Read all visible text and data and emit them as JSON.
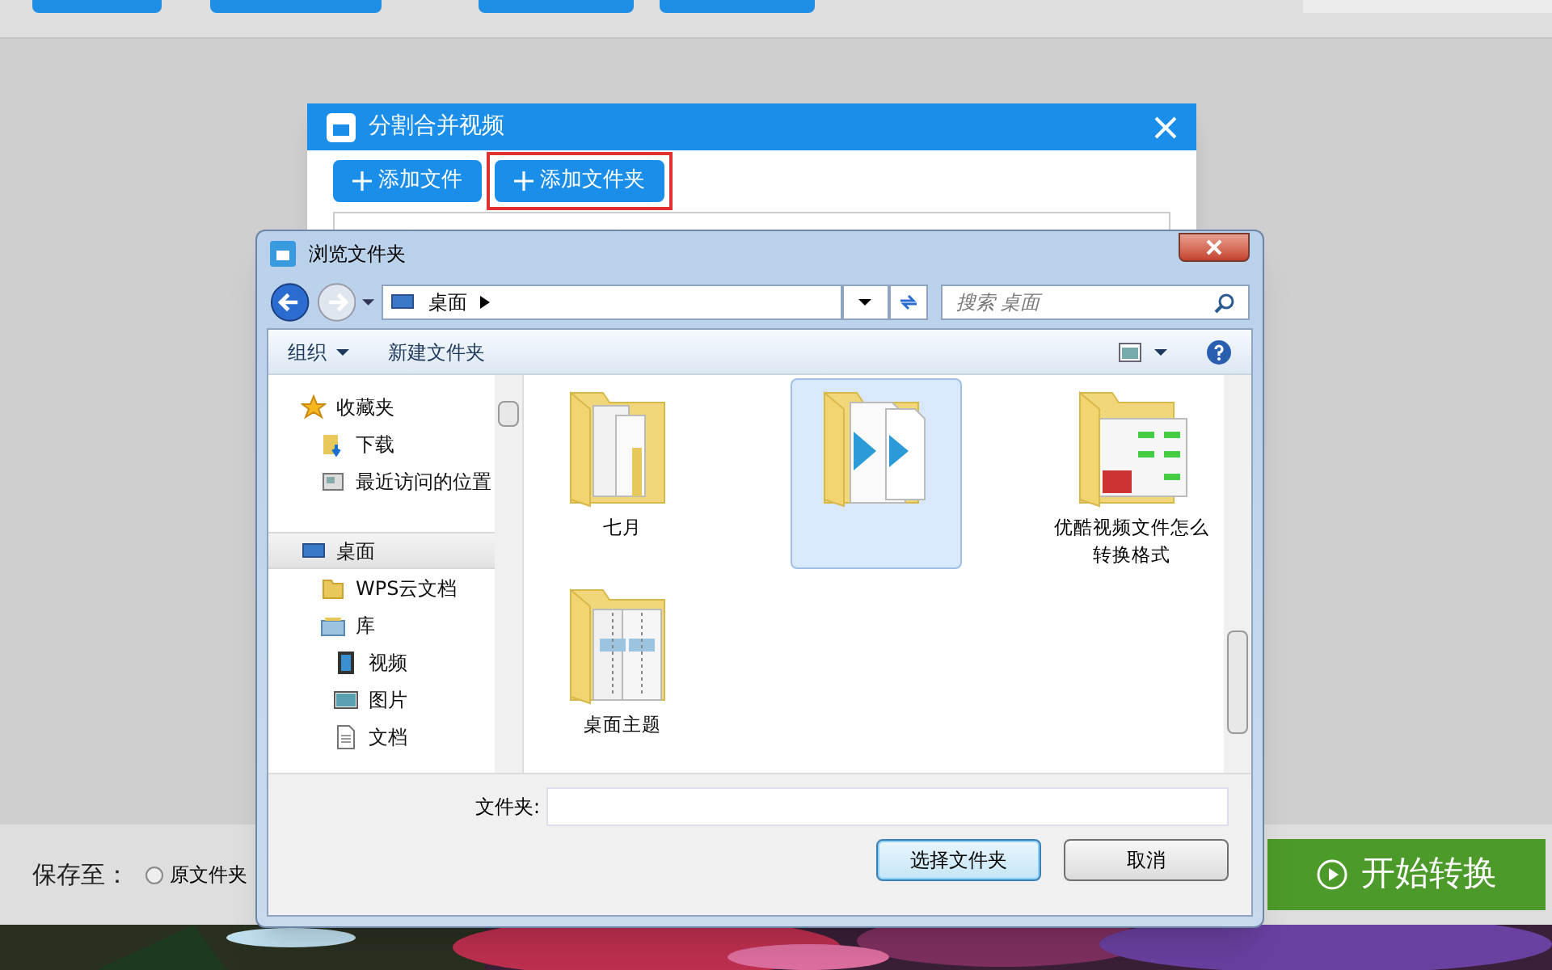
{
  "dialog": {
    "title": "分割合并视频",
    "buttons": [
      {
        "label": "添加文件",
        "highlighted": false
      },
      {
        "label": "添加文件夹",
        "highlighted": true
      }
    ]
  },
  "browser": {
    "title": "浏览文件夹",
    "breadcrumb": "桌面",
    "search": {
      "placeholder": "搜索 桌面"
    },
    "toolbar": [
      {
        "label": "组织",
        "kind": "menu"
      },
      {
        "label": "新建文件夹",
        "kind": "button"
      }
    ],
    "nav": [
      {
        "label": "收藏夹",
        "kind": "star",
        "selected": false,
        "children": [
          {
            "label": "下载",
            "kind": "download",
            "selected": false
          },
          {
            "label": "最近访问的位置",
            "kind": "recent",
            "selected": false
          }
        ]
      },
      {
        "label": "桌面",
        "kind": "desktop",
        "selected": true,
        "children": [
          {
            "label": "WPS云文档",
            "kind": "folder",
            "selected": false
          },
          {
            "label": "库",
            "kind": "library",
            "selected": false,
            "children": [
              {
                "label": "视频",
                "kind": "video",
                "selected": false
              },
              {
                "label": "图片",
                "kind": "picture",
                "selected": false
              },
              {
                "label": "文档",
                "kind": "document",
                "selected": false
              }
            ]
          }
        ]
      }
    ],
    "folders": [
      {
        "label": "七月",
        "kind": "documents",
        "selected": false
      },
      {
        "kind": "video",
        "selected": true
      },
      {
        "label": "优酷视频文件怎么转换格式",
        "kind": "screens",
        "selected": false
      },
      {
        "label": "桌面主题",
        "kind": "zipper",
        "selected": false
      }
    ],
    "folder_field": {
      "label": "文件夹:"
    },
    "actions": [
      {
        "label": "选择文件夹",
        "default": true
      },
      {
        "label": "取消",
        "default": false
      }
    ]
  },
  "footer": {
    "label": "保存至：",
    "option": {
      "label": "原文件夹",
      "selected": false
    },
    "start_button": "开始转换"
  }
}
